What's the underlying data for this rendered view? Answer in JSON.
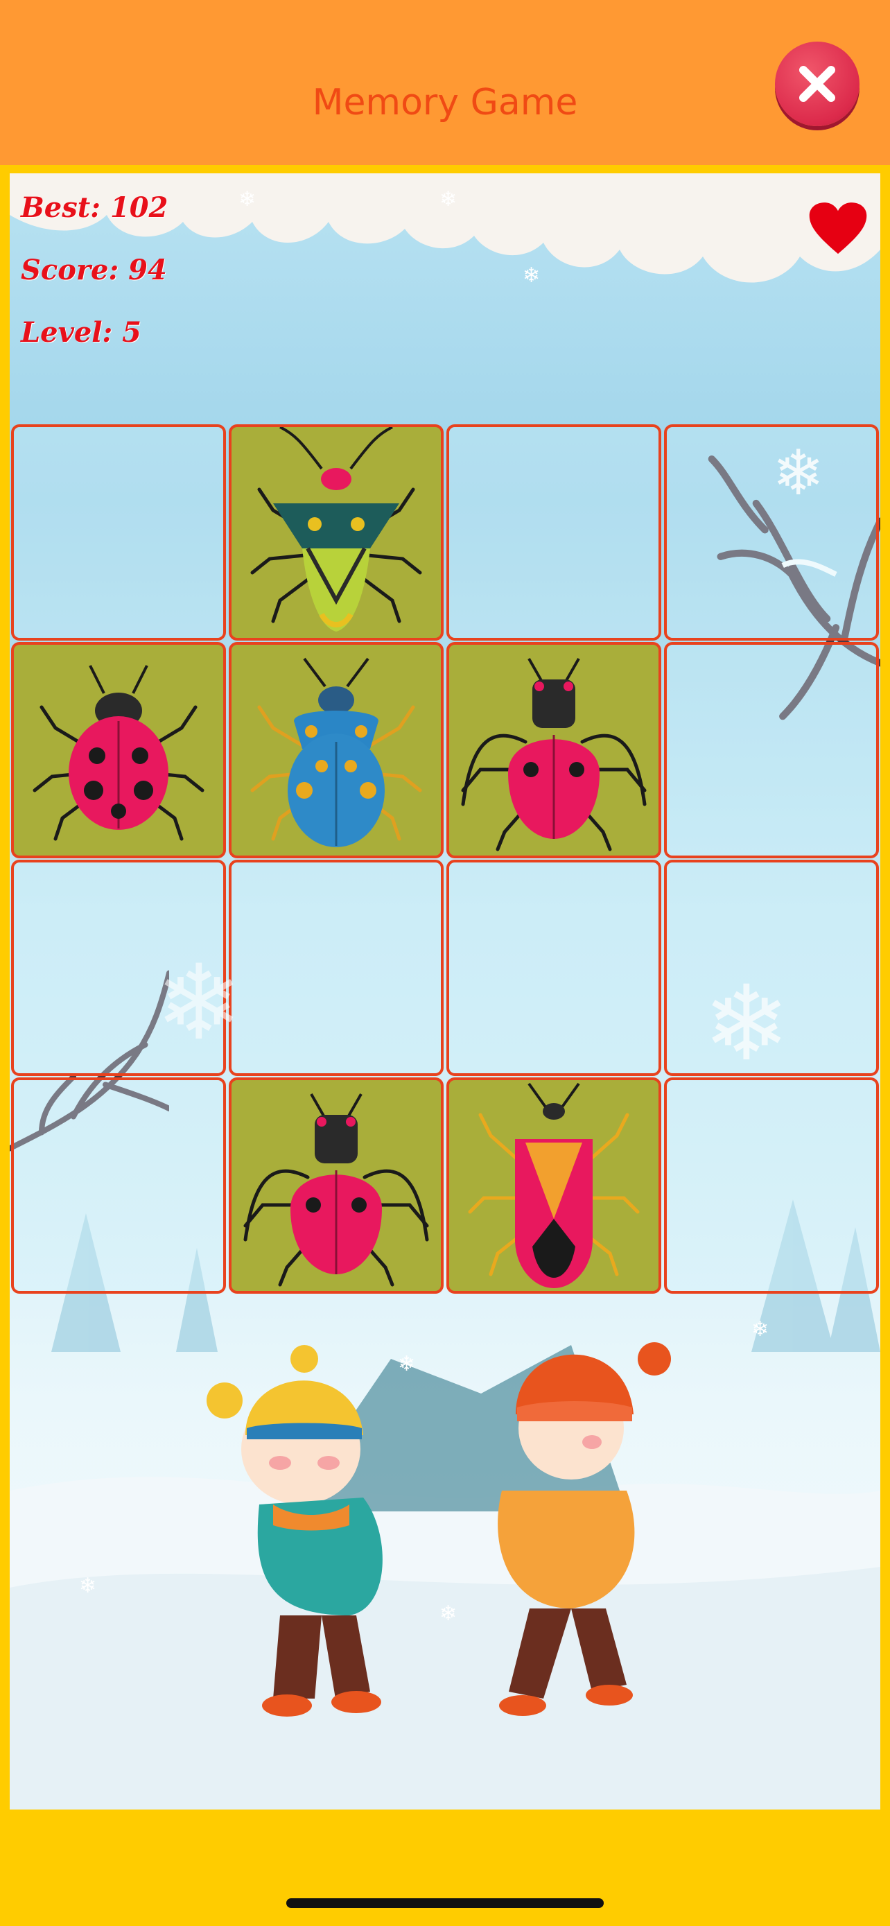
{
  "header": {
    "title": "Memory Game",
    "close_icon": "close-x-icon"
  },
  "stats": {
    "best": "Best: 102",
    "score": "Score: 94",
    "level": "Level: 5"
  },
  "lives_icon": "heart-icon",
  "colors": {
    "header_bg": "#FF9933",
    "frame_bg": "#FFCC00",
    "title": "#F04A14",
    "stat_text": "#E8101A",
    "tile_border": "#E8421E",
    "revealed_tile_bg": "#A9AE3A"
  },
  "tiles": [
    {
      "state": "hidden"
    },
    {
      "state": "revealed",
      "bug": "green-yellow-shield-bug"
    },
    {
      "state": "hidden"
    },
    {
      "state": "hidden"
    },
    {
      "state": "revealed",
      "bug": "pink-ladybug"
    },
    {
      "state": "revealed",
      "bug": "blue-spotted-bug"
    },
    {
      "state": "revealed",
      "bug": "red-long-leg-beetle"
    },
    {
      "state": "hidden"
    },
    {
      "state": "hidden"
    },
    {
      "state": "hidden"
    },
    {
      "state": "hidden"
    },
    {
      "state": "hidden"
    },
    {
      "state": "hidden"
    },
    {
      "state": "revealed",
      "bug": "red-long-leg-beetle"
    },
    {
      "state": "revealed",
      "bug": "pink-orange-shield-bug"
    },
    {
      "state": "hidden"
    }
  ]
}
